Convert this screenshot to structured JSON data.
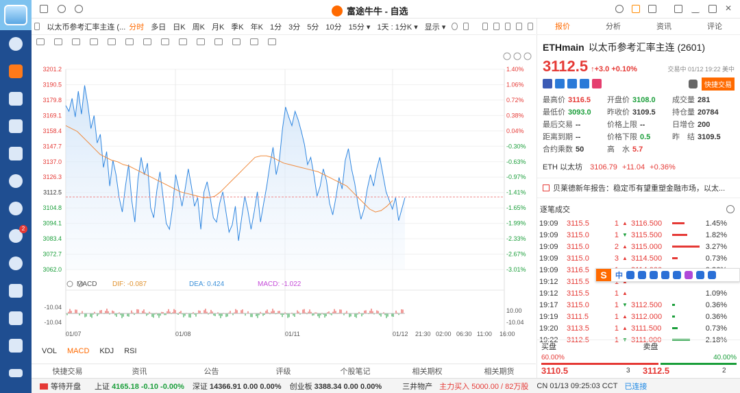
{
  "window": {
    "title": "富途牛牛 - 自选"
  },
  "left_nav": {
    "items": [
      "user",
      "quote",
      "trend",
      "watchlist",
      "funnel",
      "pie",
      "arrow",
      "message",
      "discover",
      "game",
      "code",
      "document",
      "menu"
    ],
    "message_badge": "2"
  },
  "chart_toolbar": {
    "stock_label": "以太币参考汇率主连 (...",
    "periods": [
      "分时",
      "多日",
      "日K",
      "周K",
      "月K",
      "季K",
      "年K",
      "1分",
      "3分",
      "5分",
      "10分",
      "15分 ▾",
      "1天 : 1分K ▾",
      "显示 ▾"
    ],
    "active_period": "分时"
  },
  "indicators": {
    "macd_label": "MACD",
    "dif": "DIF: -0.087",
    "dea": "DEA: 0.424",
    "macd": "MACD: -1.022",
    "tabs": [
      "VOL",
      "MACD",
      "KDJ",
      "RSI"
    ],
    "active_tab": "MACD"
  },
  "chart_data": {
    "type": "line",
    "title": "",
    "y_ticks_left": [
      "3201.2",
      "3190.5",
      "3179.8",
      "3169.1",
      "3158.4",
      "3147.7",
      "3137.0",
      "3126.3",
      "3112.5",
      "3104.8",
      "3094.1",
      "3083.4",
      "3072.7",
      "3062.0"
    ],
    "y_ticks_right": [
      "1.40%",
      "1.06%",
      "0.72%",
      "0.38%",
      "0.04%",
      "-0.30%",
      "-0.63%",
      "-0.97%",
      "-1.41%",
      "-1.65%",
      "-1.99%",
      "-2.33%",
      "-2.67%",
      "-3.01%"
    ],
    "x_ticks": [
      "01/07",
      "01/08",
      "01/11",
      "01/12",
      "21:30",
      "02:00",
      "06:30",
      "11:00",
      "16:00"
    ],
    "ylim": [
      3062.0,
      3201.2
    ],
    "current_price": 3112.5,
    "macd_ticks": [
      "-10.04",
      "-10.04",
      "10.00",
      "-10.04"
    ],
    "series": [
      {
        "values": [
          3176,
          3172,
          3181,
          3168,
          3186,
          3170,
          3190,
          3177,
          3160,
          3169,
          3150,
          3156,
          3133,
          3144,
          3120,
          3138,
          3128,
          3112,
          3102,
          3120,
          3135,
          3110,
          3095,
          3125,
          3140,
          3128,
          3136,
          3105,
          3098,
          3117,
          3130,
          3112,
          3094,
          3090,
          3105,
          3128,
          3118,
          3106,
          3118,
          3132,
          3120,
          3106,
          3112,
          3090,
          3116,
          3123,
          3112,
          3098,
          3095,
          3108,
          3116,
          3102,
          3088,
          3093,
          3106,
          3082,
          3098,
          3113,
          3103,
          3090,
          3102,
          3116,
          3095,
          3108,
          3120,
          3135,
          3147,
          3128,
          3138,
          3160,
          3175,
          3168,
          3162,
          3172,
          3166,
          3158,
          3149,
          3135,
          3140,
          3128,
          3113,
          3120,
          3132,
          3124,
          3108,
          3100,
          3112,
          3126,
          3118,
          3138,
          3146,
          3132,
          3122,
          3108,
          3097,
          3104,
          3118,
          3128,
          3120,
          3132,
          3140,
          3128,
          3116,
          3110,
          3104,
          3112,
          3096,
          3104,
          3112
        ]
      },
      {
        "values": [
          3162,
          3160,
          3158,
          3154,
          3150,
          3146,
          3142,
          3140,
          3138,
          3137,
          3135,
          3134,
          3132,
          3130,
          3128,
          3126,
          3124,
          3122,
          3120,
          3118,
          3116,
          3115,
          3114,
          3113,
          3112,
          3112,
          3113,
          3116,
          3120,
          3124,
          3128,
          3132,
          3136,
          3140,
          3141,
          3141,
          3140,
          3138,
          3136,
          3135,
          3134,
          3133,
          3132,
          3131,
          3130,
          3128,
          3126,
          3124,
          3122,
          3120,
          3116,
          3112,
          3108,
          3104,
          3102,
          3103,
          3106,
          3110
        ]
      }
    ]
  },
  "right_panel": {
    "tabs": [
      "报价",
      "分析",
      "资讯",
      "评论"
    ],
    "active_tab": "报价",
    "symbol": "ETHmain",
    "name": "以太币参考汇率主连 (2601)",
    "price": "3112.5",
    "change": "↑+3.0 +0.10%",
    "trade_time": "交易中 01/12 19:22 美中",
    "quick_trade": "快捷交易",
    "stats": [
      {
        "label": "最高价",
        "value": "3116.5",
        "color": "red"
      },
      {
        "label": "开盘价",
        "value": "3108.0",
        "color": "green"
      },
      {
        "label": "成交量",
        "value": "281",
        "color": "dark"
      },
      {
        "label": "最低价",
        "value": "3093.0",
        "color": "green"
      },
      {
        "label": "昨收价",
        "value": "3109.5",
        "color": "dark"
      },
      {
        "label": "持仓量",
        "value": "20784",
        "color": "dark"
      },
      {
        "label": "最后交易",
        "value": "--",
        "color": "dark"
      },
      {
        "label": "价格上限",
        "value": "--",
        "color": "dark"
      },
      {
        "label": "日增仓",
        "value": "200",
        "color": "dark"
      },
      {
        "label": "距离到期",
        "value": "--",
        "color": "dark"
      },
      {
        "label": "价格下限",
        "value": "0.5",
        "color": "green"
      },
      {
        "label": "昨　结",
        "value": "3109.5",
        "color": "dark"
      },
      {
        "label": "合约乘数",
        "value": "50",
        "color": "dark"
      },
      {
        "label": "高　水",
        "value": "5.7",
        "color": "red"
      }
    ],
    "eth_row": {
      "label": "ETH 以太坊",
      "price": "3106.79",
      "change": "+11.04",
      "pct": "+0.36%"
    },
    "news": "贝莱德新年报告：稳定币有望重塑金融市场，以太...",
    "trades_title": "逐笔成交",
    "trades": [
      {
        "time": "19:09",
        "price": "3115.5",
        "qty": "1",
        "dir": "up",
        "p2": "3116.500",
        "bar": 0.45,
        "bar_color": "red",
        "pct": "1.45%"
      },
      {
        "time": "19:09",
        "price": "3115.0",
        "qty": "1",
        "dir": "down",
        "p2": "3115.500",
        "bar": 0.55,
        "bar_color": "red",
        "pct": "1.82%"
      },
      {
        "time": "19:09",
        "price": "3115.0",
        "qty": "2",
        "dir": "up",
        "p2": "3115.000",
        "bar": 1.0,
        "bar_color": "red",
        "pct": "3.27%"
      },
      {
        "time": "19:09",
        "price": "3115.0",
        "qty": "3",
        "dir": "up",
        "p2": "3114.500",
        "bar": 0.2,
        "bar_color": "red",
        "pct": "0.73%"
      },
      {
        "time": "19:09",
        "price": "3116.5",
        "qty": "1",
        "dir": "up",
        "p2": "3114.000",
        "bar": 0.1,
        "bar_color": "green",
        "pct": "0.36%"
      },
      {
        "time": "19:12",
        "price": "3115.5",
        "qty": "1",
        "dir": "up",
        "p2": "",
        "bar": 0,
        "bar_color": "red",
        "pct": ""
      },
      {
        "time": "19:12",
        "price": "3115.5",
        "qty": "1",
        "dir": "up",
        "p2": "",
        "bar": 0,
        "bar_color": "red",
        "pct": "1.09%"
      },
      {
        "time": "19:17",
        "price": "3115.0",
        "qty": "1",
        "dir": "down",
        "p2": "3112.500",
        "bar": 0.1,
        "bar_color": "green",
        "pct": "0.36%"
      },
      {
        "time": "19:19",
        "price": "3111.5",
        "qty": "1",
        "dir": "up",
        "p2": "3112.000",
        "bar": 0.1,
        "bar_color": "green",
        "pct": "0.36%"
      },
      {
        "time": "19:20",
        "price": "3113.5",
        "qty": "1",
        "dir": "up",
        "p2": "3111.500",
        "bar": 0.2,
        "bar_color": "green",
        "pct": "0.73%"
      },
      {
        "time": "19:22",
        "price": "3112.5",
        "qty": "1",
        "dir": "down",
        "p2": "3111.000",
        "bar": 0.65,
        "bar_color": "green",
        "pct": "2.18%"
      }
    ],
    "bid_label": "买盘",
    "ask_label": "卖盘",
    "bid_pct": "60.00%",
    "ask_pct": "40.00%",
    "bid_price": "3110.5",
    "bid_qty": "3",
    "ask_price": "3112.5",
    "ask_qty": "2"
  },
  "bottom_tabs": [
    "快捷交易",
    "资讯",
    "公告",
    "评级",
    "个股笔记",
    "相关期权",
    "相关期货"
  ],
  "status_bar": {
    "market_status": "等待开盘",
    "sh_label": "上证",
    "sh_value": "4165.18",
    "sh_change": "-0.10",
    "sh_pct": "-0.00%",
    "sz_label": "深证",
    "sz_value": "14366.91",
    "sz_change": "0.00",
    "sz_pct": "0.00%",
    "cyb_label": "创业板",
    "cyb_value": "3388.34",
    "cyb_change": "0.00",
    "cyb_pct": "0.00%",
    "promo": "三井物产",
    "promo_flow": "主力买入 5000.00 / 82万股",
    "clock": "CN 01/13 09:25:03 CCT",
    "connection": "已连接"
  },
  "ime": {
    "zh": "中"
  }
}
